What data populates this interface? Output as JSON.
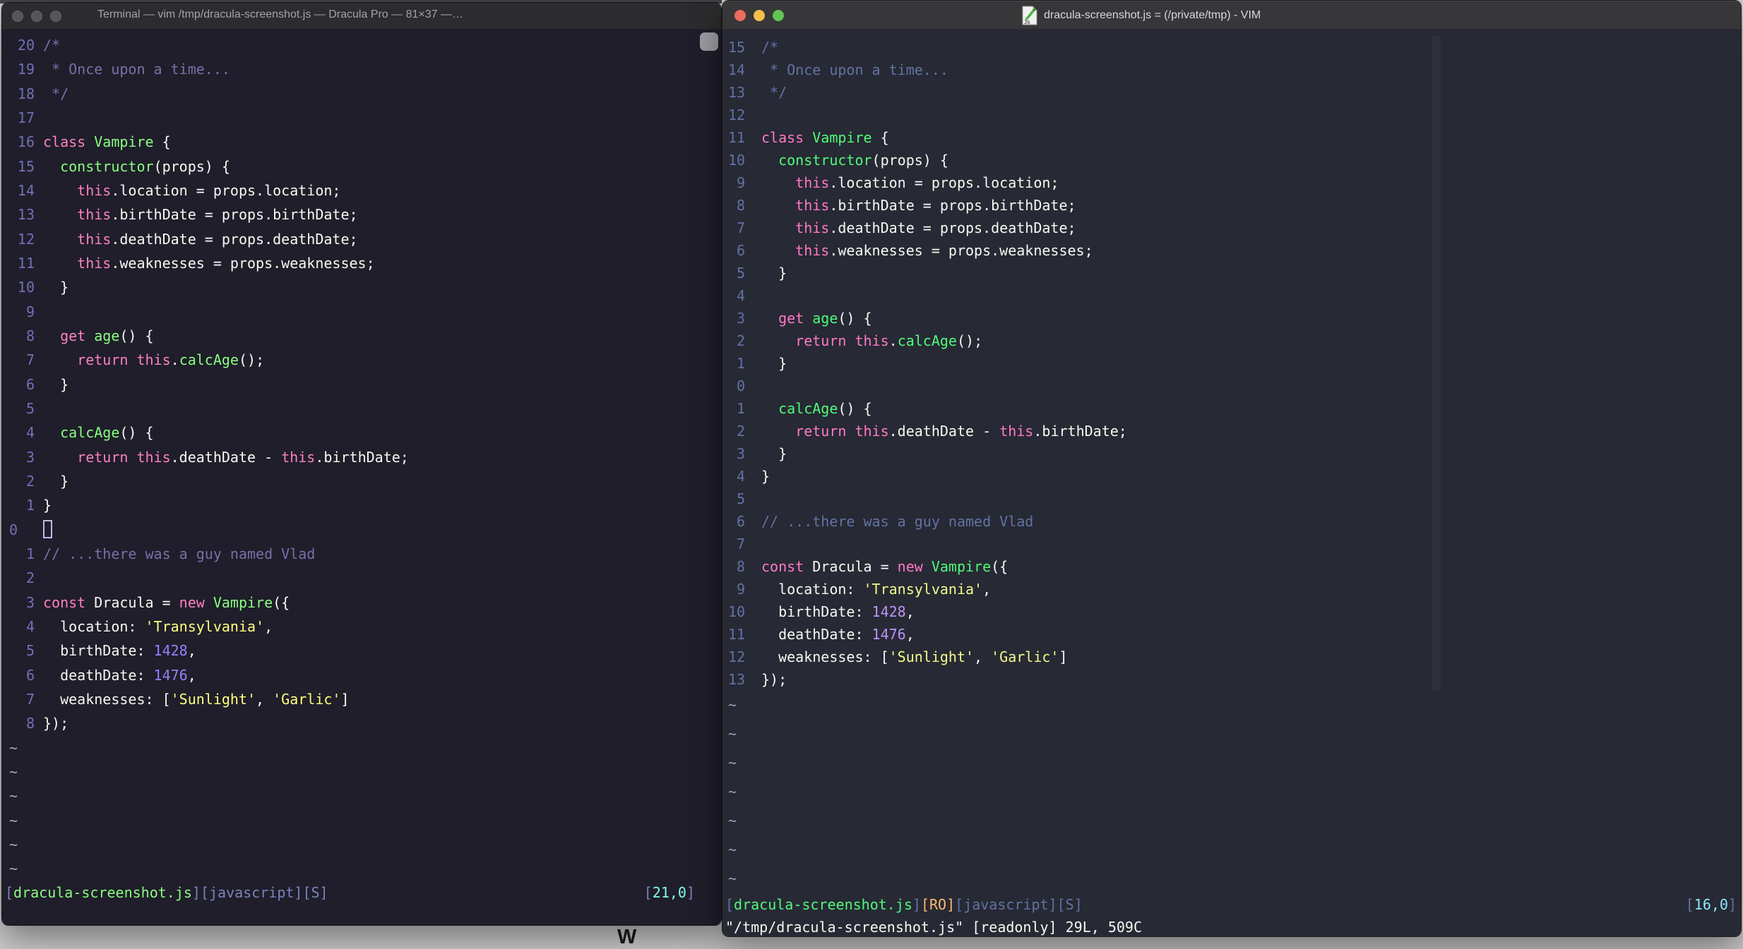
{
  "desktop": {
    "bg": "#CFCFD1",
    "top_strip_color": "#47474A",
    "partial_glyph": "W"
  },
  "palette": {
    "left": {
      "bg": "#1F1E2A",
      "titlebar": "#2C2C2E",
      "titletext": "#A2A4A8",
      "n": "#7370B8",
      "c": "#7970A9",
      "f": "#F8F8F2",
      "p": "#FF80BF",
      "g": "#8AFF80",
      "y": "#FFFF80",
      "u": "#9580FF",
      "b": "#7C83BD",
      "cy": "#80FFEA",
      "t": "#A9A9B2",
      "cursor": "#BDB9E6"
    },
    "right": {
      "bg": "#272934",
      "titlebar": "#373739",
      "titletext": "#D8D8DA",
      "n": "#6272A4",
      "c": "#6272A4",
      "f": "#F8F8F2",
      "p": "#FF79C6",
      "g": "#50FA7B",
      "y": "#F1FA8C",
      "u": "#BD93F9",
      "b": "#6272A4",
      "o": "#FFB86C",
      "cy": "#8BE9FD",
      "t": "#9DA0AD",
      "colorcolumn": "#2E303D"
    }
  },
  "traffic_lights": {
    "red": "#EC6A5E",
    "yellow": "#F4BF4F",
    "green": "#61C454",
    "inactive": "#56565A"
  },
  "code_lines": [
    [
      [
        "c",
        "/*"
      ]
    ],
    [
      [
        "c",
        " * Once upon a time..."
      ]
    ],
    [
      [
        "c",
        " */"
      ]
    ],
    [],
    [
      [
        "p",
        "class"
      ],
      [
        "f",
        " "
      ],
      [
        "g",
        "Vampire"
      ],
      [
        "f",
        " {"
      ]
    ],
    [
      [
        "f",
        "  "
      ],
      [
        "g",
        "constructor"
      ],
      [
        "f",
        "(props) {"
      ]
    ],
    [
      [
        "f",
        "    "
      ],
      [
        "p",
        "this"
      ],
      [
        "f",
        ".location = props.location;"
      ]
    ],
    [
      [
        "f",
        "    "
      ],
      [
        "p",
        "this"
      ],
      [
        "f",
        ".birthDate = props.birthDate;"
      ]
    ],
    [
      [
        "f",
        "    "
      ],
      [
        "p",
        "this"
      ],
      [
        "f",
        ".deathDate = props.deathDate;"
      ]
    ],
    [
      [
        "f",
        "    "
      ],
      [
        "p",
        "this"
      ],
      [
        "f",
        ".weaknesses = props.weaknesses;"
      ]
    ],
    [
      [
        "f",
        "  }"
      ]
    ],
    [],
    [
      [
        "f",
        "  "
      ],
      [
        "p",
        "get"
      ],
      [
        "f",
        " "
      ],
      [
        "g",
        "age"
      ],
      [
        "f",
        "() {"
      ]
    ],
    [
      [
        "f",
        "    "
      ],
      [
        "p",
        "return"
      ],
      [
        "f",
        " "
      ],
      [
        "p",
        "this"
      ],
      [
        "f",
        "."
      ],
      [
        "g",
        "calcAge"
      ],
      [
        "f",
        "();"
      ]
    ],
    [
      [
        "f",
        "  }"
      ]
    ],
    [],
    [
      [
        "f",
        "  "
      ],
      [
        "g",
        "calcAge"
      ],
      [
        "f",
        "() {"
      ]
    ],
    [
      [
        "f",
        "    "
      ],
      [
        "p",
        "return"
      ],
      [
        "f",
        " "
      ],
      [
        "p",
        "this"
      ],
      [
        "f",
        ".deathDate - "
      ],
      [
        "p",
        "this"
      ],
      [
        "f",
        ".birthDate;"
      ]
    ],
    [
      [
        "f",
        "  }"
      ]
    ],
    [
      [
        "f",
        "}"
      ]
    ],
    [],
    [
      [
        "c",
        "// ...there was a guy named Vlad"
      ]
    ],
    [],
    [
      [
        "p",
        "const"
      ],
      [
        "f",
        " Dracula = "
      ],
      [
        "p",
        "new"
      ],
      [
        "f",
        " "
      ],
      [
        "g",
        "Vampire"
      ],
      [
        "f",
        "({"
      ]
    ],
    [
      [
        "f",
        "  location: "
      ],
      [
        "y",
        "'Transylvania'"
      ],
      [
        "f",
        ","
      ]
    ],
    [
      [
        "f",
        "  birthDate: "
      ],
      [
        "u",
        "1428"
      ],
      [
        "f",
        ","
      ]
    ],
    [
      [
        "f",
        "  deathDate: "
      ],
      [
        "u",
        "1476"
      ],
      [
        "f",
        ","
      ]
    ],
    [
      [
        "f",
        "  weaknesses: ["
      ],
      [
        "y",
        "'Sunlight'"
      ],
      [
        "f",
        ", "
      ],
      [
        "y",
        "'Garlic'"
      ],
      [
        "f",
        "]"
      ]
    ],
    [
      [
        "f",
        "});"
      ]
    ]
  ],
  "windows": {
    "left": {
      "title": "Terminal — vim /tmp/dracula-screenshot.js — Dracula Pro — 81×37 —…",
      "line_numbers": [
        "20",
        "19",
        "18",
        "17",
        "16",
        "15",
        "14",
        "13",
        "12",
        "11",
        "10",
        "9",
        "8",
        "7",
        "6",
        "5",
        "4",
        "3",
        "2",
        "1",
        "0",
        "1",
        "2",
        "3",
        "4",
        "5",
        "6",
        "7",
        "8"
      ],
      "cursor_line_index": 20,
      "tilde_count": 6,
      "tilde_char": "~",
      "status": [
        [
          "b",
          "["
        ],
        [
          "g",
          "dracula-screenshot.js"
        ],
        [
          "b",
          "][javascript][S]"
        ]
      ],
      "ruler": [
        [
          "b",
          "["
        ],
        [
          "cy",
          "21,0"
        ],
        [
          "b",
          "]"
        ]
      ]
    },
    "right": {
      "title": "dracula-screenshot.js = (/private/tmp) - VIM",
      "line_numbers": [
        "15",
        "14",
        "13",
        "12",
        "11",
        "10",
        "9",
        "8",
        "7",
        "6",
        "5",
        "4",
        "3",
        "2",
        "1",
        "0",
        "1",
        "2",
        "3",
        "4",
        "5",
        "6",
        "7",
        "8",
        "9",
        "10",
        "11",
        "12",
        "13"
      ],
      "tilde_count": 7,
      "tilde_char": "~",
      "status": [
        [
          "b",
          "["
        ],
        [
          "g",
          "dracula-screenshot.js"
        ],
        [
          "b",
          "]"
        ],
        [
          "o",
          "[RO]"
        ],
        [
          "b",
          "[javascript][S]"
        ]
      ],
      "ruler": [
        [
          "b",
          "["
        ],
        [
          "cy",
          "16,0"
        ],
        [
          "b",
          "]"
        ]
      ],
      "cmdline": "\"/tmp/dracula-screenshot.js\" [readonly] 29L, 509C"
    }
  }
}
